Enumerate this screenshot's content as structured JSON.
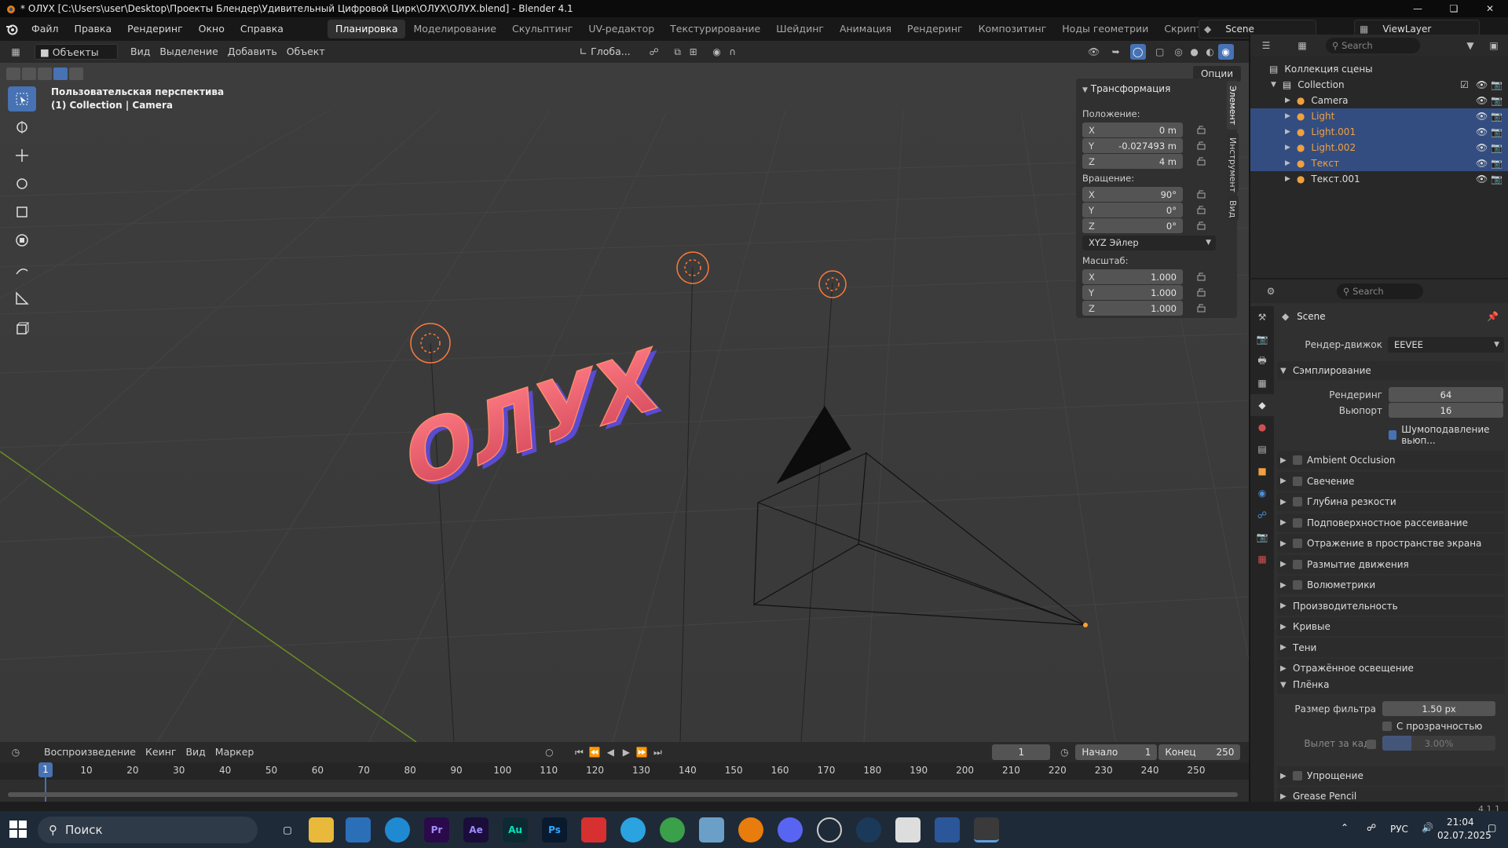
{
  "window": {
    "title": "* ОЛУХ [C:\\Users\\user\\Desktop\\Проекты Блендер\\Удивительный Цифровой Цирк\\ОЛУХ\\ОЛУХ.blend] - Blender 4.1"
  },
  "menu": [
    "Файл",
    "Правка",
    "Рендеринг",
    "Окно",
    "Справка"
  ],
  "workspaces": [
    "Планировка",
    "Моделирование",
    "Скульптинг",
    "UV-редактор",
    "Текстурирование",
    "Шейдинг",
    "Анимация",
    "Рендеринг",
    "Композитинг",
    "Ноды геометрии",
    "Скриптинг"
  ],
  "active_workspace": "Планировка",
  "scene_name": "Scene",
  "view_layer": "ViewLayer",
  "viewport_header": {
    "mode": "Объекты",
    "view": "Вид",
    "select": "Выделение",
    "add": "Добавить",
    "object": "Объект",
    "orientation": "Глоба...",
    "options": "Опции"
  },
  "viewport": {
    "perspective_label": "Пользовательская перспектива",
    "collection_label": "(1) Collection | Camera",
    "scene_text": "ОЛУХ"
  },
  "npanel": {
    "title": "Трансформация",
    "position_label": "Положение:",
    "position": [
      {
        "axis": "X",
        "value": "0 m"
      },
      {
        "axis": "Y",
        "value": "-0.027493 m"
      },
      {
        "axis": "Z",
        "value": "4 m"
      }
    ],
    "rotation_label": "Вращение:",
    "rotation": [
      {
        "axis": "X",
        "value": "90°"
      },
      {
        "axis": "Y",
        "value": "0°"
      },
      {
        "axis": "Z",
        "value": "0°"
      }
    ],
    "rotation_mode": "XYZ Эйлер",
    "scale_label": "Масштаб:",
    "scale": [
      {
        "axis": "X",
        "value": "1.000"
      },
      {
        "axis": "Y",
        "value": "1.000"
      },
      {
        "axis": "Z",
        "value": "1.000"
      }
    ],
    "tabs": [
      "Элемент",
      "Инструмент",
      "Вид"
    ]
  },
  "outliner": {
    "search_placeholder": "Search",
    "root": "Коллекция сцены",
    "collection": "Collection",
    "items": [
      {
        "name": "Camera",
        "selected": false,
        "color": "#dcdcdc"
      },
      {
        "name": "Light",
        "selected": true,
        "color": "#f0a040"
      },
      {
        "name": "Light.001",
        "selected": true,
        "color": "#f0a040"
      },
      {
        "name": "Light.002",
        "selected": true,
        "color": "#f0a040"
      },
      {
        "name": "Текст",
        "selected": true,
        "color": "#f0a040"
      },
      {
        "name": "Текст.001",
        "selected": false,
        "color": "#dcdcdc"
      }
    ]
  },
  "properties": {
    "search_placeholder": "Search",
    "scene_label": "Scene",
    "render_engine_label": "Рендер-движок",
    "render_engine": "EEVEE",
    "sampling": "Сэмплирование",
    "render_label": "Рендеринг",
    "render_samples": "64",
    "viewport_label": "Вьюпорт",
    "viewport_samples": "16",
    "denoise": "Шумоподавление вьюп...",
    "panels": [
      "Ambient Occlusion",
      "Свечение",
      "Глубина резкости",
      "Подповерхностное рассеивание",
      "Отражение в пространстве экрана",
      "Размытие движения",
      "Волюметрики",
      "Производительность",
      "Кривые",
      "Тени",
      "Отражённое освещение"
    ],
    "film": "Плёнка",
    "filter_size_label": "Размер фильтра",
    "filter_size": "1.50 px",
    "transparent": "С прозрачностью",
    "overscan_label": "Вылет за кадр",
    "overscan": "3.00%",
    "simplify": "Упрощение",
    "grease_pencil": "Grease Pencil"
  },
  "timeline": {
    "playback": "Воспроизведение",
    "keying": "Кеинг",
    "view": "Вид",
    "marker": "Маркер",
    "current_frame": "1",
    "start_label": "Начало",
    "start": "1",
    "end_label": "Конец",
    "end": "250",
    "ticks": [
      "1",
      "10",
      "20",
      "30",
      "40",
      "50",
      "60",
      "70",
      "80",
      "90",
      "100",
      "110",
      "120",
      "130",
      "140",
      "150",
      "160",
      "170",
      "180",
      "190",
      "200",
      "210",
      "220",
      "230",
      "240",
      "250"
    ]
  },
  "version": "4.1.1",
  "taskbar": {
    "search": "Поиск",
    "lang": "РУС",
    "time": "21:04",
    "date": "02.07.2025",
    "apps": [
      "Pr",
      "Ae",
      "Au",
      "Ps"
    ]
  }
}
